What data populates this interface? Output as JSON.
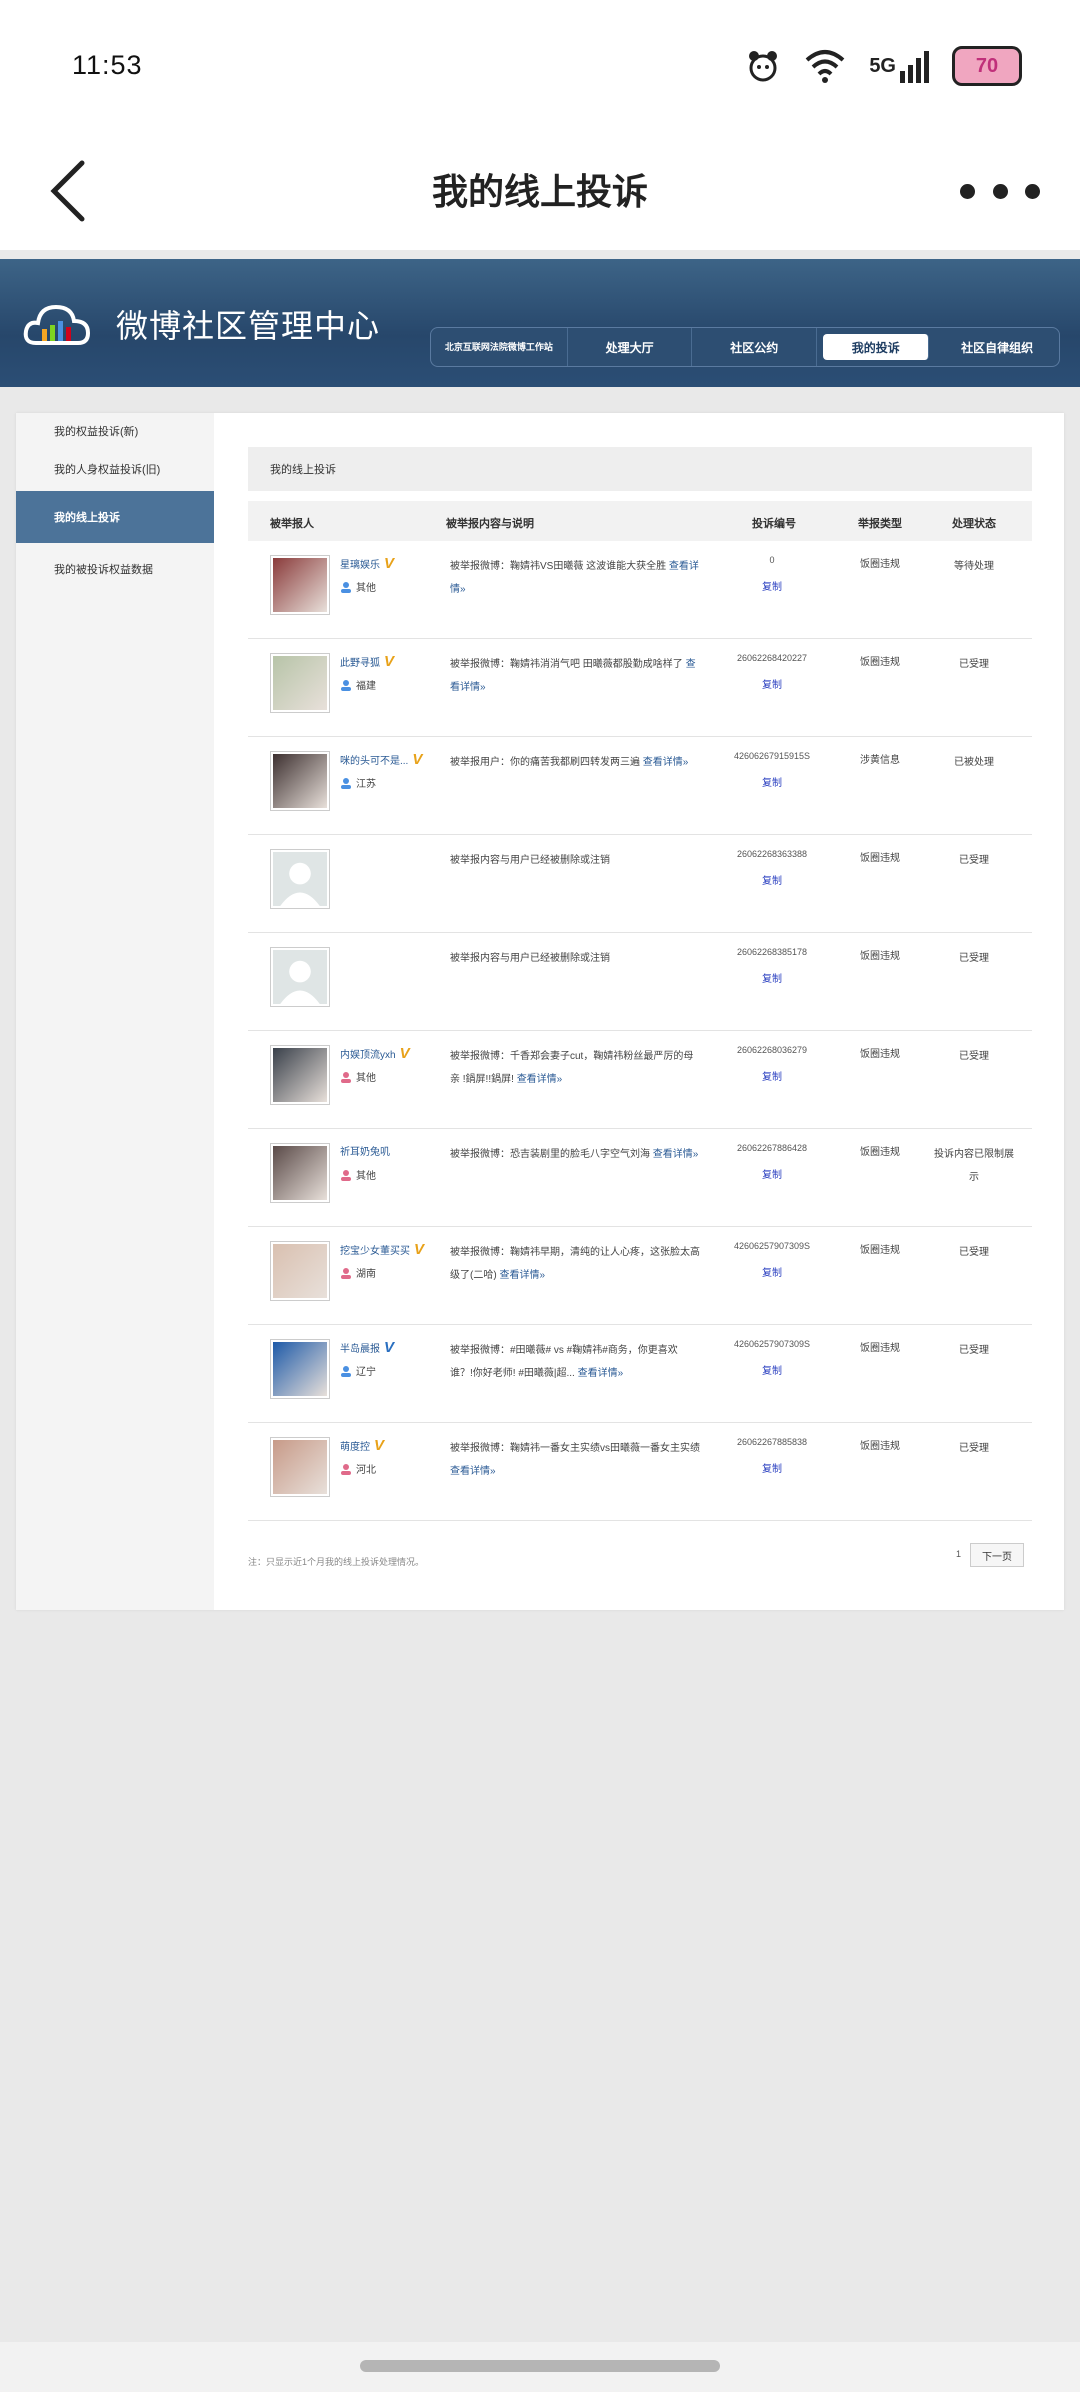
{
  "status_bar": {
    "time": "11:53",
    "network": "5G",
    "battery": "70"
  },
  "app_header": {
    "title": "我的线上投诉"
  },
  "site": {
    "brand": "微博社区管理中心",
    "nav": [
      {
        "label": "北京互联网法院微博工作站"
      },
      {
        "label": "处理大厅"
      },
      {
        "label": "社区公约"
      },
      {
        "label": "我的投诉"
      },
      {
        "label": "社区自律组织"
      }
    ]
  },
  "sidebar": {
    "items": [
      {
        "label": "我的权益投诉(新)"
      },
      {
        "label": "我的人身权益投诉(旧)"
      },
      {
        "label": "我的线上投诉"
      },
      {
        "label": "我的被投诉权益数据"
      }
    ]
  },
  "main": {
    "section_title": "我的线上投诉",
    "columns": [
      "被举报人",
      "被举报内容与说明",
      "投诉编号",
      "举报类型",
      "处理状态"
    ],
    "rows": [
      {
        "name": "星璃娱乐",
        "loc": "其他",
        "desc": "被举报微博：鞠婧祎VS田曦薇 这波谁能大获全胜",
        "link": "查看详情»",
        "id": "0",
        "copy": "复制",
        "type": "饭圈违规",
        "status": "等待处理"
      },
      {
        "name": "此野寻狐",
        "loc": "福建",
        "desc": "被举报微博：鞠婧祎消消气吧 田曦薇都股勤成啥样了",
        "link": "查看详情»",
        "id": "26062268420227",
        "copy": "复制",
        "type": "饭圈违规",
        "status": "已受理"
      },
      {
        "name": "咪的头可不是...",
        "loc": "江苏",
        "desc": "被举报用户：你的痛苦我都刷四转发两三遍",
        "link": "查看详情»",
        "id": "42606267915915S",
        "copy": "复制",
        "type": "涉黄信息",
        "status": "已被处理"
      },
      {
        "name": "",
        "loc": "",
        "desc": "被举报内容与用户已经被删除或注销",
        "link": "",
        "id": "26062268363388",
        "copy": "复制",
        "type": "饭圈违规",
        "status": "已受理"
      },
      {
        "name": "",
        "loc": "",
        "desc": "被举报内容与用户已经被删除或注销",
        "link": "",
        "id": "26062268385178",
        "copy": "复制",
        "type": "饭圈违规",
        "status": "已受理"
      },
      {
        "name": "内娱顶流yxh",
        "loc": "其他",
        "desc": "被举报微博：千香郑会妻子cut，鞠婧祎粉丝最严厉的母亲 !鍋屏!!鍋屏!",
        "link": "查看详情»",
        "id": "26062268036279",
        "copy": "复制",
        "type": "饭圈违规",
        "status": "已受理"
      },
      {
        "name": "祈耳奶兔叽",
        "loc": "其他",
        "desc": "被举报微博：恐吉装剧里的脸毛八字空气刘海",
        "link": "查看详情»",
        "id": "26062267886428",
        "copy": "复制",
        "type": "饭圈违规",
        "status": "投诉内容已限制展示"
      },
      {
        "name": "挖宝少女董买买",
        "loc": "湖南",
        "desc": "被举报微博：鞠婧祎早期，清纯的让人心疼，这张脸太高级了(二哈)",
        "link": "查看详情»",
        "id": "42606257907309S",
        "copy": "复制",
        "type": "饭圈违规",
        "status": "已受理"
      },
      {
        "name": "半岛晨报",
        "loc": "辽宁",
        "desc": "被举报微博：#田曦薇# vs #鞠婧祎#商务，你更喜欢谁？!你好老师! #田曦薇|超...",
        "link": "查看详情»",
        "id": "42606257907309S",
        "copy": "复制",
        "type": "饭圈违规",
        "status": "已受理"
      },
      {
        "name": "萌度控",
        "loc": "河北",
        "desc": "被举报微博：鞠婧祎一番女主实绩vs田曦薇一番女主实绩",
        "link": "查看详情»",
        "id": "26062267885838",
        "copy": "复制",
        "type": "饭圈违规",
        "status": "已受理"
      }
    ],
    "footer_note": "注：只显示近1个月我的线上投诉处理情况。",
    "page": "1",
    "next_label": "下一页"
  }
}
